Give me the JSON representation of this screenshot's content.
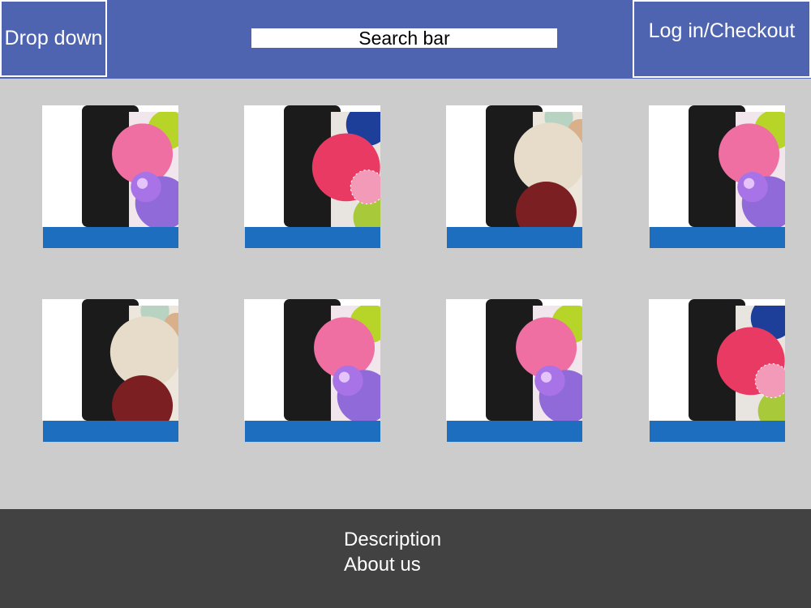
{
  "header": {
    "dropdown_label": "Drop down",
    "search_placeholder": "Search bar",
    "login_label": "Log in/Checkout"
  },
  "products": [
    {
      "image": "phone-pink-icon"
    },
    {
      "image": "phone-red-icon"
    },
    {
      "image": "phone-beige-icon"
    },
    {
      "image": "phone-pink-icon"
    },
    {
      "image": "phone-beige-icon"
    },
    {
      "image": "phone-pink-icon"
    },
    {
      "image": "phone-pink-icon"
    },
    {
      "image": "phone-red-icon"
    }
  ],
  "footer": {
    "description_label": "Description",
    "about_label": "About us"
  },
  "colors": {
    "header_bg": "#4f64b0",
    "page_bg": "#cccccc",
    "product_bar": "#1e6ec0",
    "footer_bg": "#424242"
  }
}
